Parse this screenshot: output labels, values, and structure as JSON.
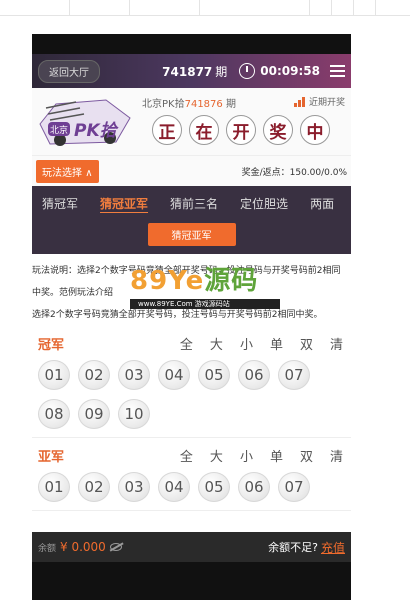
{
  "header": {
    "back_label": "返回大厅",
    "period_number": "741877",
    "period_unit": "期",
    "countdown": "00:09:58"
  },
  "draw": {
    "logo_text": "北京PK拾",
    "game_name": "北京PK拾",
    "last_period": "741876",
    "period_unit": "期",
    "trend_label": "近期开奖",
    "status_chars": [
      "正",
      "在",
      "开",
      "奖",
      "中"
    ]
  },
  "play": {
    "select_label": "玩法选择",
    "odds_text": "奖金/返点：150.00/0.0%"
  },
  "tabs": [
    "猜冠军",
    "猜冠亚军",
    "猜前三名",
    "定位胆选",
    "两面"
  ],
  "active_tab": 1,
  "subtab_label": "猜冠亚军",
  "description": {
    "line1": "玩法说明：选择2个数字号码竞猜全部开奖号码，投注号码与开奖号码前2相同",
    "line2": "中奖。范例玩法介绍",
    "line3": "选择2个数字号码竞猜全部开奖号码，投注号码与开奖号码前2相同中奖。"
  },
  "watermark": {
    "main_a": "89Ye",
    "main_b": "源码",
    "sub": "www.89YE.Com 游戏源码站"
  },
  "sections": [
    {
      "title": "冠军",
      "filters": [
        "全",
        "大",
        "小",
        "单",
        "双",
        "清"
      ],
      "balls": [
        "01",
        "02",
        "03",
        "04",
        "05",
        "06",
        "07",
        "08",
        "09",
        "10"
      ]
    },
    {
      "title": "亚军",
      "filters": [
        "全",
        "大",
        "小",
        "单",
        "双",
        "清"
      ],
      "balls": [
        "01",
        "02",
        "03",
        "04",
        "05",
        "06",
        "07"
      ]
    }
  ],
  "footer": {
    "balance_label": "余额",
    "balance_value": "¥ 0.000",
    "low_balance_text": "余额不足?",
    "recharge_label": "充值"
  },
  "colors": {
    "accent": "#f06b2d",
    "tab_bg": "#393041",
    "status_char": "#8b1d2c"
  }
}
